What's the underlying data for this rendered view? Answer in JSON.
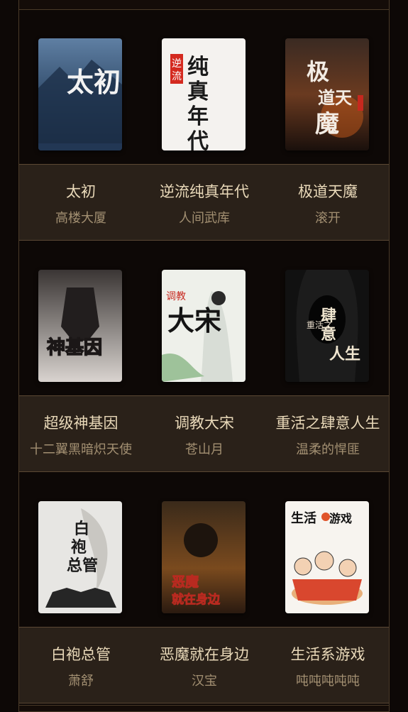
{
  "books": [
    {
      "title": "太初",
      "author": "高楼大厦",
      "cover_text": "太初"
    },
    {
      "title": "逆流纯真年代",
      "author": "人间武库",
      "cover_text": "纯真年代"
    },
    {
      "title": "极道天魔",
      "author": "滚开",
      "cover_text": "极道天魔"
    },
    {
      "title": "超级神基因",
      "author": "十二翼黑暗炽天使",
      "cover_text": "神基因"
    },
    {
      "title": "调教大宋",
      "author": "苍山月",
      "cover_text": "大宋"
    },
    {
      "title": "重活之肆意人生",
      "author": "温柔的悍匪",
      "cover_text": "肆意人生"
    },
    {
      "title": "白袍总管",
      "author": "萧舒",
      "cover_text": "白袍总管"
    },
    {
      "title": "恶魔就在身边",
      "author": "汉宝",
      "cover_text": "恶魔就在身边"
    },
    {
      "title": "生活系游戏",
      "author": "吨吨吨吨吨",
      "cover_text": "生活系游戏"
    }
  ],
  "colors": {
    "background": "#0d0806",
    "info_bg": "#2a2119",
    "title": "#e9d9b9",
    "author": "#a39072",
    "border": "#4a3a28"
  }
}
